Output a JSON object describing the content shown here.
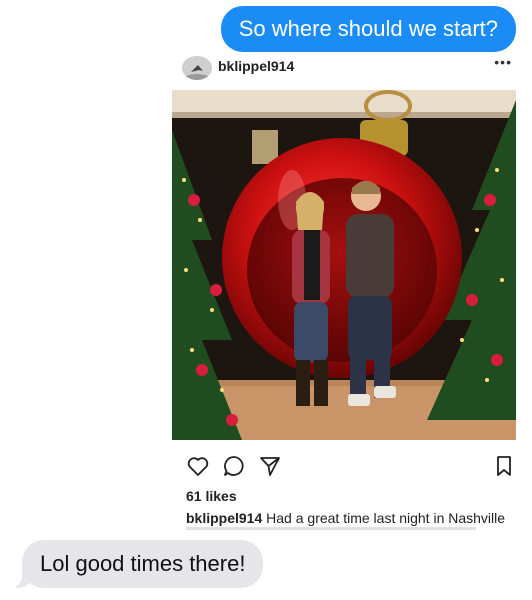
{
  "messages": {
    "outgoing_1": "So where should we start?",
    "incoming_1": "Lol good times there!"
  },
  "post": {
    "username": "bklippel914",
    "more_label": "•••",
    "likes": "61 likes",
    "caption_user": "bklippel914",
    "caption_text": " Had a great time last night in Nashville",
    "icons": [
      "heart-icon",
      "comment-icon",
      "share-icon",
      "bookmark-icon"
    ]
  },
  "colors": {
    "outgoing_bubble": "#1b8cf5",
    "incoming_bubble": "#e6e6ea"
  }
}
